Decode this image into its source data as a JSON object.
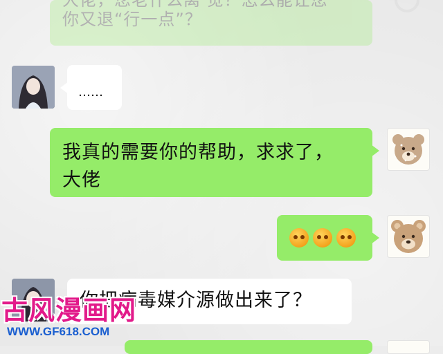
{
  "chat": {
    "messages": [
      {
        "side": "right",
        "text": "大佬，您老什么离 觉？怎么能让您\n你又退“行一点”？",
        "partially_hidden": true
      },
      {
        "side": "left",
        "text": "……"
      },
      {
        "side": "right",
        "text": "我真的需要你的帮助，求求了，\n大佬"
      },
      {
        "side": "right",
        "type": "emoji",
        "count": 3
      },
      {
        "side": "left",
        "text": "你把病毒媒介源做出来了？",
        "partially_hidden": true
      }
    ]
  },
  "watermark": {
    "title": "古风漫画网",
    "url": "WWW.GF618.COM"
  },
  "colors": {
    "bubble_green": "#95ec69",
    "bubble_white": "#ffffff",
    "background": "#ececec",
    "watermark_pink": "#e21a8a",
    "watermark_blue": "#1b5fd0"
  }
}
